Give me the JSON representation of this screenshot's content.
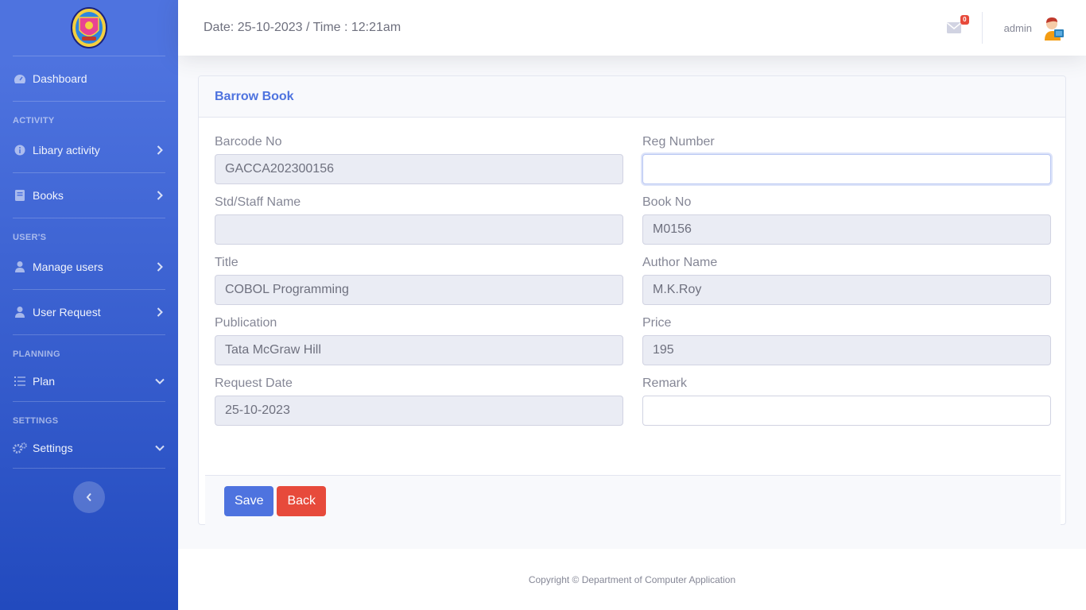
{
  "sidebar": {
    "logo_icon": "college-crest-logo",
    "items": [
      {
        "label": "Dashboard",
        "icon": "tachometer-icon"
      },
      {
        "label": "Libary activity",
        "icon": "info-circle-icon"
      },
      {
        "label": "Books",
        "icon": "book-icon"
      },
      {
        "label": "Manage users",
        "icon": "user-icon"
      },
      {
        "label": "User Request",
        "icon": "user-icon"
      },
      {
        "label": "Plan",
        "icon": "list-icon"
      },
      {
        "label": "Settings",
        "icon": "cogs-icon"
      }
    ],
    "headings": {
      "activity": "ACTIVITY",
      "users": "USER'S",
      "planning": "PLANNING",
      "settings": "SETTINGS"
    }
  },
  "topbar": {
    "datetime": "Date: 25-10-2023 / Time : 12:21am",
    "mail_count": "0",
    "username": "admin"
  },
  "form": {
    "title": "Barrow Book",
    "fields": {
      "barcode": {
        "label": "Barcode No",
        "value": "GACCA202300156"
      },
      "reg": {
        "label": "Reg Number",
        "value": ""
      },
      "name": {
        "label": "Std/Staff Name",
        "value": ""
      },
      "bookno": {
        "label": "Book No",
        "value": "M0156"
      },
      "title": {
        "label": "Title",
        "value": "COBOL Programming"
      },
      "author": {
        "label": "Author Name",
        "value": "M.K.Roy"
      },
      "publication": {
        "label": "Publication",
        "value": "Tata McGraw Hill"
      },
      "price": {
        "label": "Price",
        "value": "195"
      },
      "reqdate": {
        "label": "Request Date",
        "value": "25-10-2023"
      },
      "remark": {
        "label": "Remark",
        "value": ""
      }
    },
    "save_label": "Save",
    "back_label": "Back"
  },
  "footer": {
    "copyright": "Copyright © Department of Computer Application"
  },
  "colors": {
    "primary": "#4e73df",
    "danger": "#e74a3b",
    "sidebar_top": "#4e73df",
    "sidebar_bottom": "#224abe"
  }
}
